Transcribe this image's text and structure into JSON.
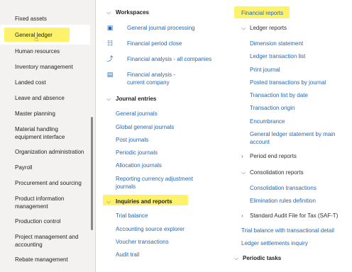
{
  "nav": {
    "items": [
      {
        "label": "Fixed assets"
      },
      {
        "label": "General ledger"
      },
      {
        "label": "Human resources"
      },
      {
        "label": "Inventory management"
      },
      {
        "label": "Landed cost"
      },
      {
        "label": "Leave and absence"
      },
      {
        "label": "Master planning"
      },
      {
        "label": "Material handling equipment interface"
      },
      {
        "label": "Organization administration"
      },
      {
        "label": "Payroll"
      },
      {
        "label": "Procurement and sourcing"
      },
      {
        "label": "Product information management"
      },
      {
        "label": "Production control"
      },
      {
        "label": "Project management and accounting"
      },
      {
        "label": "Rebate management"
      }
    ]
  },
  "workspaces": {
    "title": "Workspaces",
    "items": [
      {
        "label": "General journal processing",
        "icon": "workspace-tile-icon"
      },
      {
        "label": "Financial period close",
        "icon": "checklist-icon"
      },
      {
        "label": "Financial analysis - all companies",
        "icon": "trend-icon"
      },
      {
        "label": "Financial analysis - current company",
        "icon": "report-page-icon"
      }
    ]
  },
  "journal_entries": {
    "title": "Journal entries",
    "items": [
      "General journals",
      "Global general journals",
      "Post journals",
      "Periodic journals",
      "Allocation journals",
      "Reporting currency adjustment journals"
    ]
  },
  "inquiries": {
    "title": "Inquiries and reports",
    "items": [
      "Trial balance",
      "Accounting source explorer",
      "Voucher transactions",
      "Audit trail"
    ]
  },
  "financial_reports": {
    "title": "Financial reports",
    "ledger_reports": {
      "title": "Ledger reports",
      "items": [
        "Dimension statement",
        "Ledger transaction list",
        "Print journal",
        "Posted transactions by journal",
        "Transaction list by date",
        "Transaction origin",
        "Encumbrance",
        "General ledger statement by main account"
      ]
    },
    "period_end": "Period end reports",
    "consolidation": {
      "title": "Consolidation reports",
      "items": [
        "Consolidation transactions",
        "Elimination rules definition"
      ]
    },
    "saft": "Standard Audit File for Tax (SAF-T)",
    "trial_balance_tx": "Trial balance with transactional detail",
    "ledger_settlements": "Ledger settlements inquiry",
    "periodic_tasks": "Periodic tasks"
  },
  "colors": {
    "link": "#2867b2",
    "highlight": "#fff26b",
    "nav_bg": "#f3f2f1"
  }
}
